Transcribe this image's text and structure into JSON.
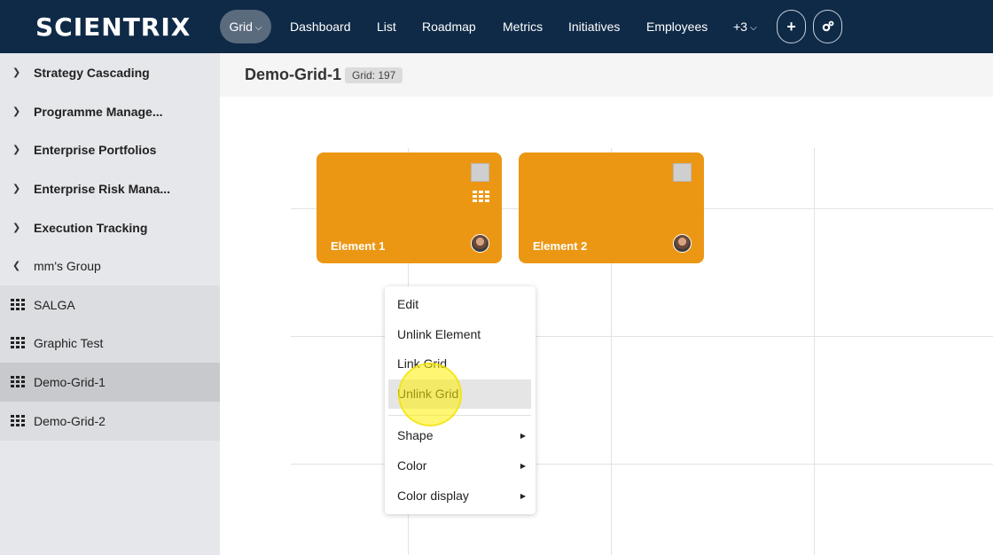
{
  "app": {
    "logo_text": "SCIENTRIX"
  },
  "topnav": {
    "grid_label": "Grid",
    "items": [
      "Dashboard",
      "List",
      "Roadmap",
      "Metrics",
      "Initiatives",
      "Employees"
    ],
    "more_label": "+3",
    "add_icon": "plus-icon",
    "settings_icon": "cogs-icon"
  },
  "sidebar": {
    "groups": [
      {
        "label": "Strategy Cascading",
        "expanded": false
      },
      {
        "label": "Programme Manage...",
        "expanded": false
      },
      {
        "label": "Enterprise Portfolios",
        "expanded": false
      },
      {
        "label": "Enterprise Risk Mana...",
        "expanded": false
      },
      {
        "label": "Execution Tracking",
        "expanded": false
      },
      {
        "label": "mm's Group",
        "expanded": true
      }
    ],
    "grids": [
      {
        "label": "SALGA"
      },
      {
        "label": "Graphic Test"
      },
      {
        "label": "Demo-Grid-1",
        "active": true
      },
      {
        "label": "Demo-Grid-2"
      }
    ]
  },
  "page": {
    "title": "Demo-Grid-1",
    "badge": "Grid: 197"
  },
  "elements": [
    {
      "name": "Element 1",
      "color": "#ec9714"
    },
    {
      "name": "Element 2",
      "color": "#ec9714"
    }
  ],
  "context_menu": {
    "items": [
      {
        "label": "Edit"
      },
      {
        "label": "Unlink Element"
      },
      {
        "label": "Link Grid"
      },
      {
        "label": "Unlink Grid",
        "hovered": true
      },
      {
        "label": "Shape",
        "submenu": true
      },
      {
        "label": "Color",
        "submenu": true
      },
      {
        "label": "Color display",
        "submenu": true
      }
    ]
  },
  "colors": {
    "topbar": "#0f2a47",
    "accent_orange": "#ec9714",
    "sidebar_bg": "#e6e7eb"
  }
}
